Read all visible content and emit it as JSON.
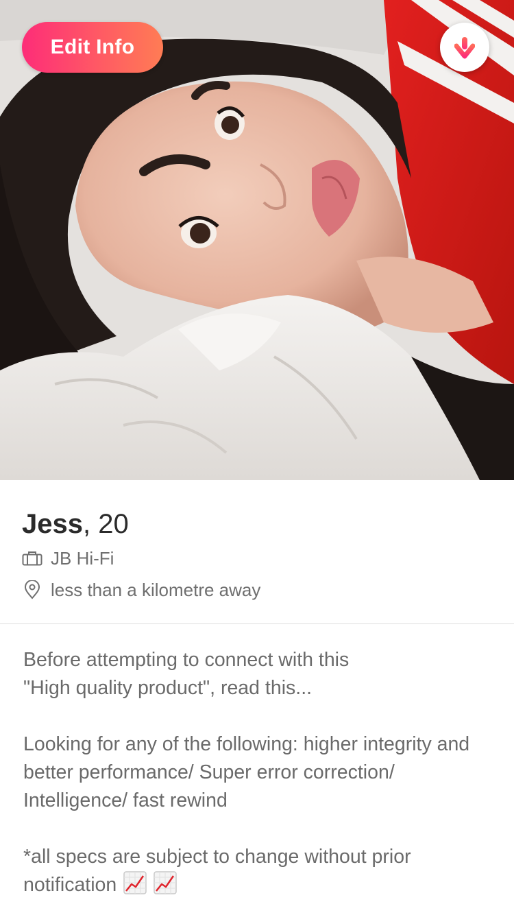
{
  "header": {
    "edit_button_label": "Edit Info",
    "collapse_icon": "arrow-down-icon",
    "accent_gradient": [
      "#fd2d78",
      "#ff7c54"
    ]
  },
  "profile": {
    "name": "Jess",
    "separator": ",",
    "age": "20",
    "work_icon": "briefcase-icon",
    "work": "JB Hi-Fi",
    "location_icon": "location-pin-icon",
    "distance": "less than a kilometre away"
  },
  "bio": {
    "paragraph_1": "Before attempting to connect with this\n\"High quality product\", read this...",
    "paragraph_2": "Looking for any of the following: higher integrity and better performance/ Super error correction/ Intelligence/ fast rewind",
    "paragraph_3": "*all specs are subject to change without prior notification",
    "trailing_emoji": [
      "chart-increasing-icon",
      "chart-increasing-icon"
    ]
  },
  "colors": {
    "name_text": "#2b2b2b",
    "secondary_text": "#6f6f6f",
    "divider": "#dedede"
  }
}
